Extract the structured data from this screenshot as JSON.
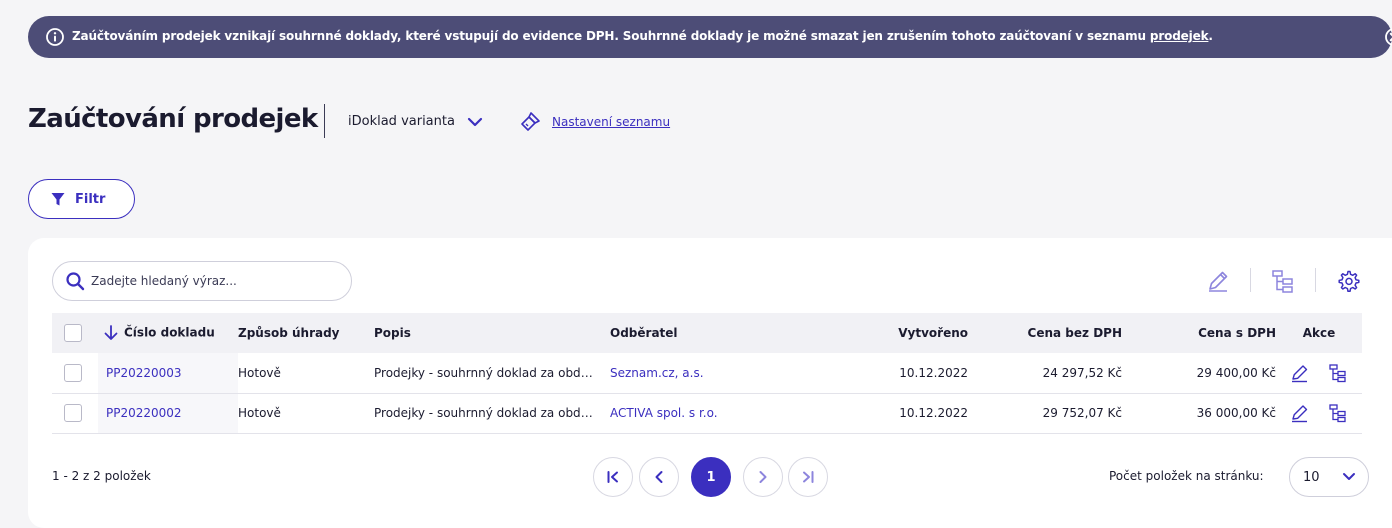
{
  "banner": {
    "text_before": "Zaúčtováním prodejek vznikají souhrnné doklady, které vstupují do evidence DPH. Souhrnné doklady je možné smazat jen zrušením tohoto zaúčtovaní v seznamu",
    "link_text": "prodejek",
    "text_after": "."
  },
  "header": {
    "title": "Zaúčtování prodejek",
    "variant_label": "iDoklad varianta",
    "settings_link": "Nastavení seznamu"
  },
  "filter": {
    "label": "Filtr"
  },
  "search": {
    "placeholder": "Zadejte hledaný výraz..."
  },
  "table": {
    "columns": [
      "Číslo dokladu",
      "Způsob úhrady",
      "Popis",
      "Odběratel",
      "Vytvořeno",
      "Cena bez DPH",
      "Cena s DPH",
      "Akce"
    ],
    "rows": [
      {
        "number": "PP20220003",
        "payment": "Hotově",
        "description": "Prodejky - souhrnný doklad za období",
        "customer": "Seznam.cz, a.s.",
        "created": "10.12.2022",
        "price_excl": "24 297,52 Kč",
        "price_incl": "29 400,00 Kč"
      },
      {
        "number": "PP20220002",
        "payment": "Hotově",
        "description": "Prodejky - souhrnný doklad za období",
        "customer": "ACTIVA spol. s r.o.",
        "created": "10.12.2022",
        "price_excl": "29 752,07 Kč",
        "price_incl": "36 000,00 Kč"
      }
    ]
  },
  "footer": {
    "count_text": "1 - 2 z 2 položek",
    "current_page": "1",
    "per_page_label": "Počet položek na stránku:",
    "per_page_value": "10"
  },
  "colors": {
    "accent": "#3b2fbf",
    "banner_bg": "#4d4d77",
    "toolbar_icon": "#6a5fd6"
  }
}
